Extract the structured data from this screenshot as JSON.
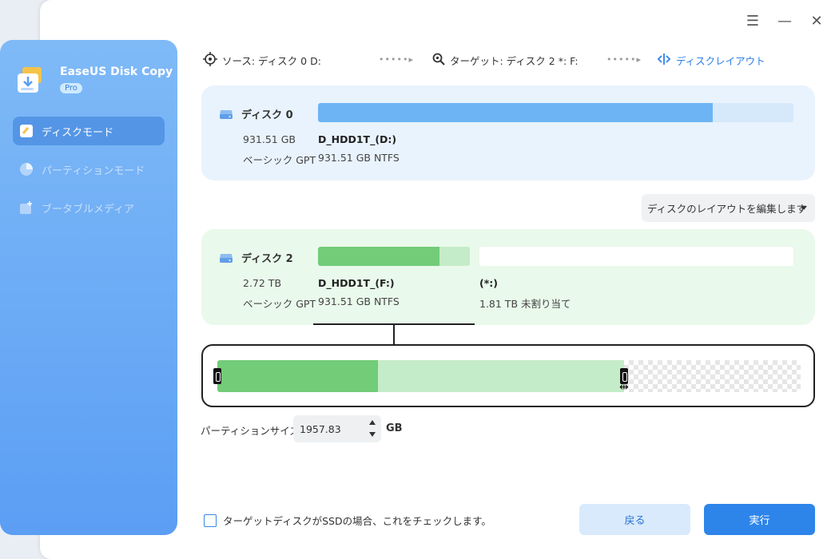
{
  "app": {
    "name": "EaseUS Disk Copy",
    "badge": "Pro"
  },
  "sidebar": {
    "items": [
      {
        "label": "ディスクモード",
        "active": true,
        "icon": "disk-mode-icon"
      },
      {
        "label": "パーティションモード",
        "active": false,
        "icon": "pie-icon"
      },
      {
        "label": "ブータブルメディア",
        "active": false,
        "icon": "bootable-media-icon"
      }
    ]
  },
  "window_controls": {
    "menu": "☰",
    "minimize": "—",
    "close": "✕"
  },
  "steps": {
    "source": "ソース: ディスク 0 D:",
    "target": "ターゲット: ディスク 2 *: F:",
    "layout": "ディスクレイアウト",
    "separator": "•••••▸"
  },
  "source_disk": {
    "name": "ディスク 0",
    "size": "931.51 GB",
    "type": "ベーシック GPT",
    "partition_name": "D_HDD1T_(D:)",
    "partition_detail": "931.51 GB NTFS",
    "used_fraction": 0.83
  },
  "layout_dropdown": {
    "label": "ディスクのレイアウトを編集します"
  },
  "target_disk": {
    "name": "ディスク 2",
    "size": "2.72 TB",
    "type": "ベーシック GPT",
    "partition_name": "D_HDD1T_(F:)",
    "partition_detail": "931.51 GB NTFS",
    "partition_used_fraction": 0.8,
    "unallocated_name": "(*:)",
    "unallocated_detail": "1.81 TB 未割り当て"
  },
  "editor": {
    "used_fraction": 0.275,
    "partition_fraction": 0.695
  },
  "partition_size": {
    "label": "パーティションサイズ",
    "value": "1957.83",
    "unit": "GB"
  },
  "ssd_option": {
    "label": "ターゲットディスクがSSDの場合、これをチェックします。",
    "checked": false
  },
  "buttons": {
    "back": "戻る",
    "run": "実行"
  },
  "colors": {
    "accent": "#2d85ea",
    "source_bar": "#6db4f4",
    "source_bar_bg": "#d6e9fb",
    "partition_used": "#72cc78",
    "partition_free": "#c5ecc8"
  }
}
